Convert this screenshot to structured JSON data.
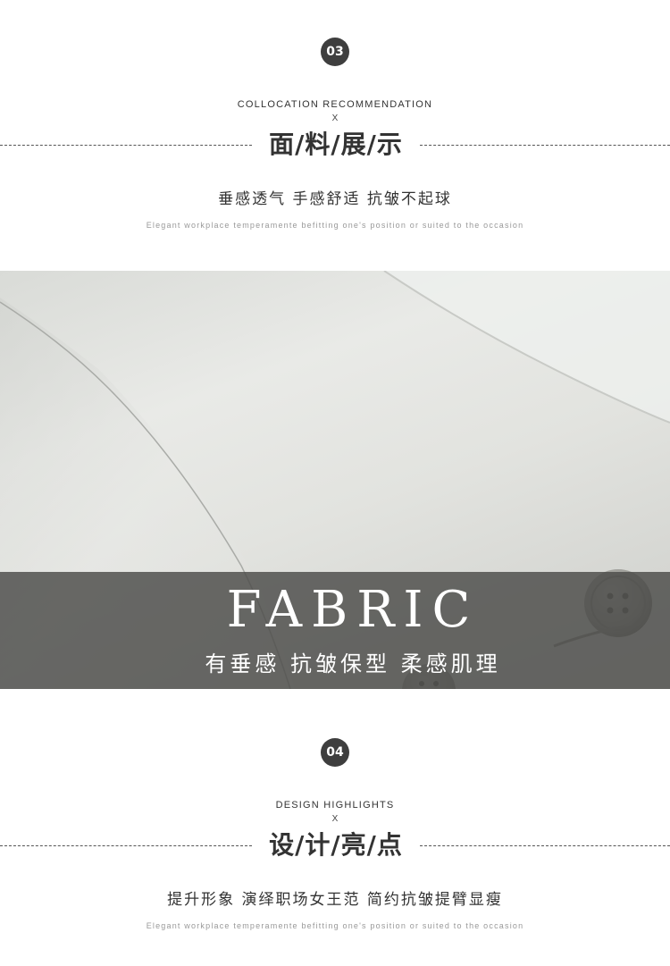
{
  "section_03": {
    "number": "03",
    "eyebrow": "COLLOCATION RECOMMENDATION",
    "x_mark": "X",
    "title": "面/料/展/示",
    "subtitle": "垂感透气 手感舒适 抗皱不起球",
    "tagline": "Elegant workplace temperamente befitting one's position or suited to the occasion"
  },
  "fabric_banner": {
    "title": "FABRIC",
    "subtitle": "有垂感 抗皱保型 柔感肌理"
  },
  "section_04": {
    "number": "04",
    "eyebrow": "DESIGN HIGHLIGHTS",
    "x_mark": "X",
    "title": "设/计/亮/点",
    "subtitle": "提升形象 演绎职场女王范 简约抗皱提臂显瘦",
    "tagline": "Elegant workplace temperamente befitting one's position or suited to the occasion"
  },
  "colors": {
    "badge": "#3e3e3e",
    "band": "#4b4b48",
    "fabric": "#e2e3df"
  }
}
